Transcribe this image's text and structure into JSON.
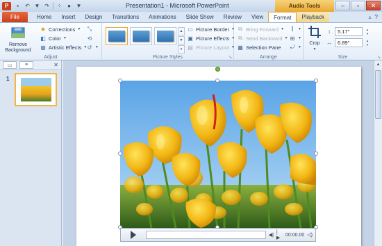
{
  "titlebar": {
    "app_icon": "P",
    "title": "Presentation1 - Microsoft PowerPoint",
    "tools_label": "Audio Tools"
  },
  "tabs": [
    "File",
    "Home",
    "Insert",
    "Design",
    "Transitions",
    "Animations",
    "Slide Show",
    "Review",
    "View",
    "Format",
    "Playback"
  ],
  "active_tab": "Format",
  "ribbon": {
    "adjust": {
      "remove_bg": "Remove Background",
      "corrections": "Corrections",
      "color": "Color",
      "artistic": "Artistic Effects",
      "label": "Adjust"
    },
    "picture_styles": {
      "border": "Picture Border",
      "effects": "Picture Effects",
      "layout": "Picture Layout",
      "label": "Picture Styles"
    },
    "arrange": {
      "bring_forward": "Bring Forward",
      "send_backward": "Send Backward",
      "selection_pane": "Selection Pane",
      "label": "Arrange"
    },
    "size": {
      "crop": "Crop",
      "height": "5.17\"",
      "width": "6.89\"",
      "label": "Size"
    }
  },
  "slides_panel": {
    "slide_number": "1"
  },
  "media": {
    "time": "00:00.00"
  },
  "colors": {
    "file_tab": "#c8401e",
    "tools_tab": "#e9a935",
    "ribbon_bg": "#e4edf8",
    "workspace_bg": "#c4d3e6",
    "rotation_handle": "#74c04a"
  }
}
